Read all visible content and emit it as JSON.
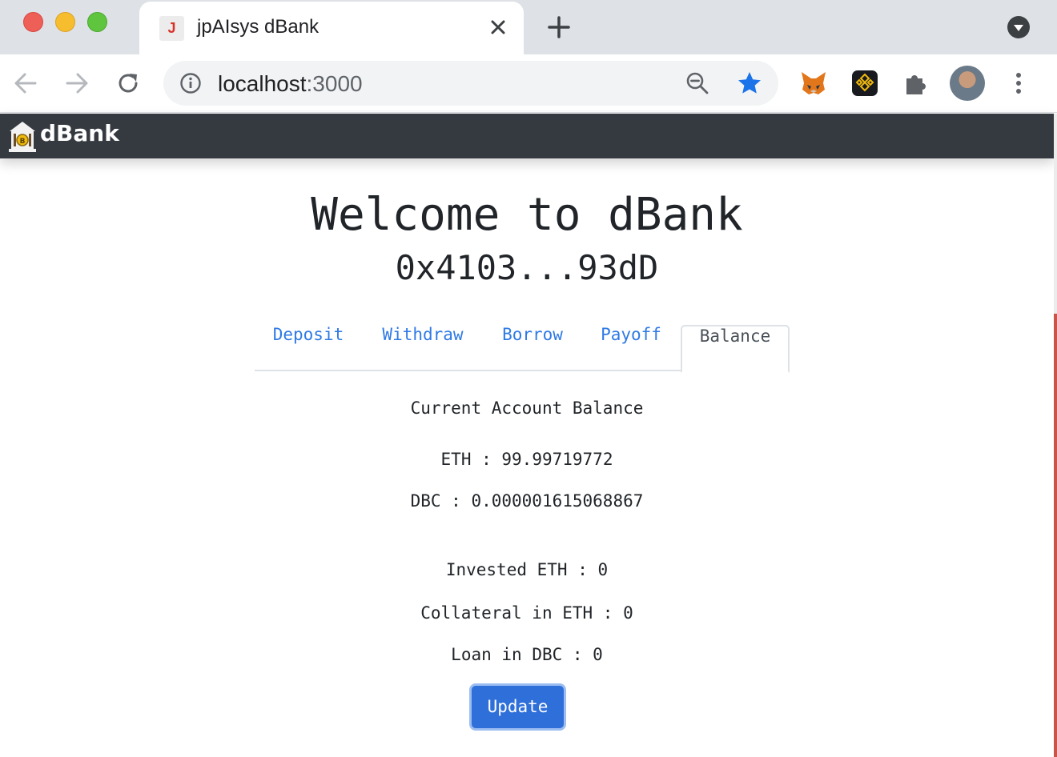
{
  "browser": {
    "tab_title": "jpAIsys dBank",
    "tab_favicon_letter": "J",
    "url_host": "localhost",
    "url_port": ":3000"
  },
  "icons": {
    "back": "arrow-left-icon",
    "forward": "arrow-right-icon",
    "reload": "reload-icon",
    "info": "info-icon",
    "zoom": "zoom-out-icon",
    "bookmark": "star-icon",
    "metamask": "fox-icon",
    "binance": "binance-icon",
    "extensions": "puzzle-icon",
    "menu": "kebab-menu-icon"
  },
  "navbar": {
    "brand": "dBank"
  },
  "main": {
    "welcome": "Welcome to dBank",
    "account": "0x4103...93dD",
    "tabs": [
      {
        "label": "Deposit",
        "active": false
      },
      {
        "label": "Withdraw",
        "active": false
      },
      {
        "label": "Borrow",
        "active": false
      },
      {
        "label": "Payoff",
        "active": false
      },
      {
        "label": "Balance",
        "active": true
      }
    ],
    "balance": {
      "heading": "Current Account Balance",
      "eth": "ETH : 99.99719772",
      "dbc": "DBC : 0.000001615068867",
      "invested": "Invested ETH : 0",
      "collateral": "Collateral in ETH : 0",
      "loan": "Loan in DBC : 0",
      "update_label": "Update"
    }
  },
  "colors": {
    "navbar": "#343a40",
    "link": "#2f7ae5",
    "button": "#2f6fd9",
    "star": "#1a73e8"
  }
}
